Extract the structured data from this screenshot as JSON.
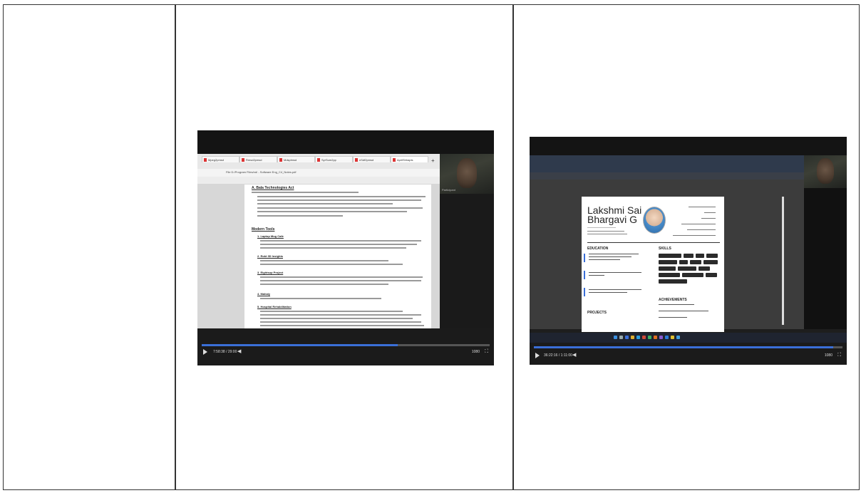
{
  "left_recording": {
    "player": {
      "elapsed": "7:58:38 / 29:00",
      "progress": 0.68,
      "right_label": "1080"
    },
    "browser_tabs": [
      "Mpeg2pmsd",
      "Rmsd2pmsd",
      "Mdsplmsd",
      "SyrSum2pp",
      "nSdf2pmsd",
      "AprilShhapis"
    ],
    "address": "File  D:/Program Files/nd/ - Software  Eng_C4_Notes.pdf",
    "doc_headings": [
      "A. Bala Technologies Act",
      "Modern Tools",
      "1. Laptop Mug Cafe",
      "2. Rokt 3D Insights",
      "3. Eightsup Project",
      "4. Mahaly",
      "5. Hospital Rehabilitation"
    ],
    "webcam_label": "Participant"
  },
  "right_recording": {
    "player": {
      "elapsed": "36:22:16 / 1:11:00",
      "progress": 0.97,
      "right_label": "1080"
    },
    "resume": {
      "first_name": "Lakshmi Sai",
      "last_name": "Bhargavi G",
      "sections": {
        "education": "EDUCATION",
        "skills": "SKILLS",
        "achievements": "ACHIEVEMENTS",
        "projects": "PROJECTS"
      }
    }
  }
}
